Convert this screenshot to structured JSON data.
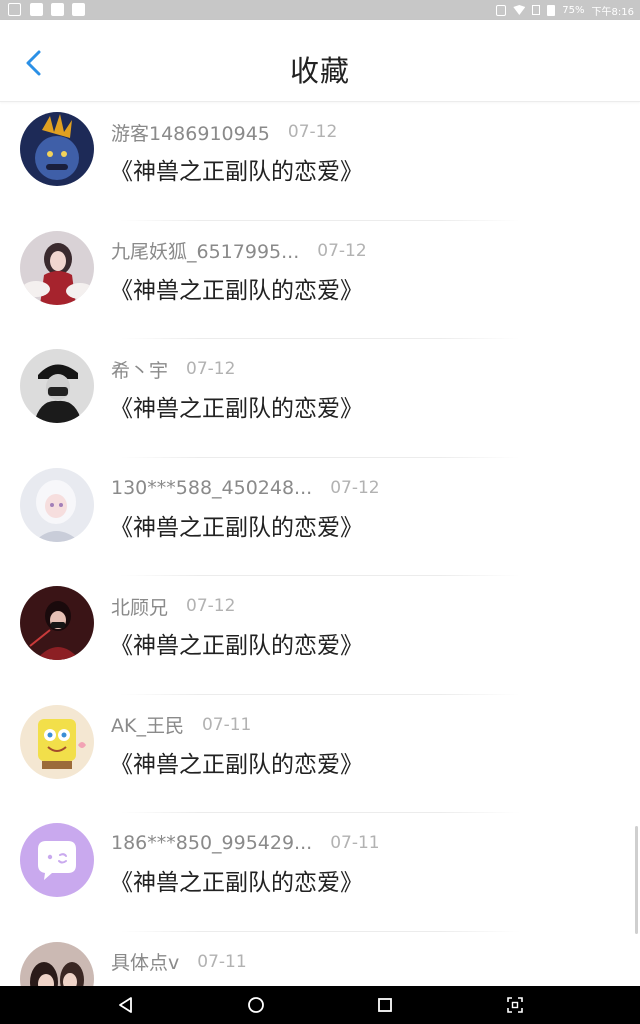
{
  "status_bar": {
    "battery": "75%",
    "time": "下午8:16"
  },
  "header": {
    "title": "收藏",
    "back_icon": "chevron-left-icon"
  },
  "accent_color": "#2b90e6",
  "favorites": [
    {
      "username": "游客1486910945",
      "date": "07-12",
      "title": "《神兽之正副队的恋爱》"
    },
    {
      "username": "九尾妖狐_6517995...",
      "date": "07-12",
      "title": "《神兽之正副队的恋爱》"
    },
    {
      "username": "希丶宇",
      "date": "07-12",
      "title": "《神兽之正副队的恋爱》"
    },
    {
      "username": "130***588_450248...",
      "date": "07-12",
      "title": "《神兽之正副队的恋爱》"
    },
    {
      "username": "北顾兄",
      "date": "07-12",
      "title": "《神兽之正副队的恋爱》"
    },
    {
      "username": "AK_王民",
      "date": "07-11",
      "title": "《神兽之正副队的恋爱》"
    },
    {
      "username": "186***850_995429...",
      "date": "07-11",
      "title": "《神兽之正副队的恋爱》"
    },
    {
      "username": "具体点v",
      "date": "07-11",
      "title": ""
    }
  ],
  "nav_bar": {
    "back_icon": "triangle-back-icon",
    "home_icon": "circle-home-icon",
    "recents_icon": "square-recents-icon",
    "screenshot_icon": "screenshot-icon"
  }
}
